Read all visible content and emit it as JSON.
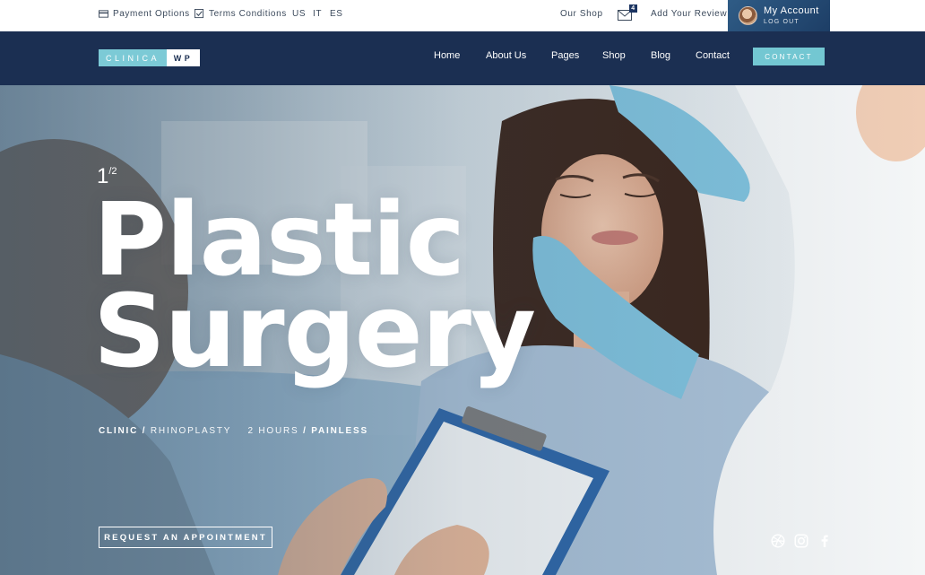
{
  "topbar": {
    "payment": "Payment Options",
    "terms": "Terms Conditions",
    "languages": [
      "US",
      "IT",
      "ES"
    ],
    "shop": "Our Shop",
    "mail_count": "4",
    "review": "Add Your Review",
    "account_title": "My Account",
    "account_sub": "LOG OUT"
  },
  "logo": {
    "part1": "CLINICA",
    "part2": "WP"
  },
  "nav": {
    "items": [
      "Home",
      "About Us",
      "Pages",
      "Shop",
      "Blog",
      "Contact"
    ],
    "cta": "CONTACT"
  },
  "hero": {
    "slide_current": "1",
    "slide_total": "/2",
    "title_line1": "Plastic",
    "title_line2": "Surgery",
    "tag1": "CLINIC",
    "tag2": "RHINOPLASTY",
    "tag3": "2 HOURS",
    "tag4": "PAINLESS",
    "button": "REQUEST AN APPOINTMENT"
  },
  "social_icons": [
    "dribbble-icon",
    "instagram-icon",
    "facebook-icon"
  ],
  "colors": {
    "navbar": "#1b2f52",
    "accent": "#73c7d2",
    "account_bg": "#2f5c86"
  }
}
